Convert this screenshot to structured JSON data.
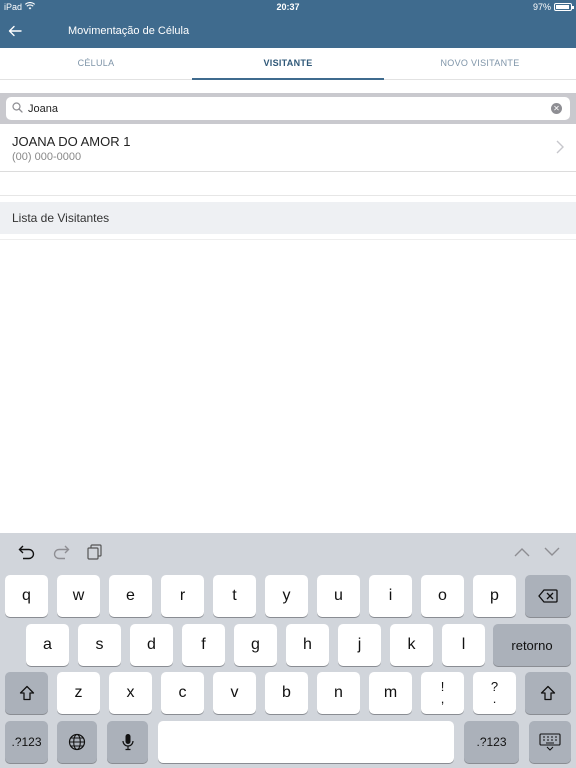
{
  "status": {
    "device": "iPad",
    "time": "20:37",
    "battery": "97%"
  },
  "nav": {
    "title": "Movimentação de Célula",
    "back_icon": "arrow-left-icon"
  },
  "tabs": [
    {
      "label": "CÉLULA",
      "active": false
    },
    {
      "label": "VISITANTE",
      "active": true
    },
    {
      "label": "NOVO VISITANTE",
      "active": false
    }
  ],
  "search": {
    "value": "Joana",
    "placeholder": ""
  },
  "result": {
    "name": "JOANA DO AMOR 1",
    "phone": "(00) 000-0000"
  },
  "section": {
    "title": "Lista de Visitantes"
  },
  "keyboard": {
    "row1": [
      "q",
      "w",
      "e",
      "r",
      "t",
      "y",
      "u",
      "i",
      "o",
      "p"
    ],
    "row2": [
      "a",
      "s",
      "d",
      "f",
      "g",
      "h",
      "j",
      "k",
      "l"
    ],
    "row3": [
      "z",
      "x",
      "c",
      "v",
      "b",
      "n",
      "m"
    ],
    "punct1": {
      "top": "!",
      "bottom": ","
    },
    "punct2": {
      "top": "?",
      "bottom": "."
    },
    "return_label": "retorno",
    "num_label": ".?123"
  },
  "colors": {
    "brand": "#3f6b8e",
    "tab_active": "#2f5878",
    "tab_inactive": "#7e94a8"
  }
}
